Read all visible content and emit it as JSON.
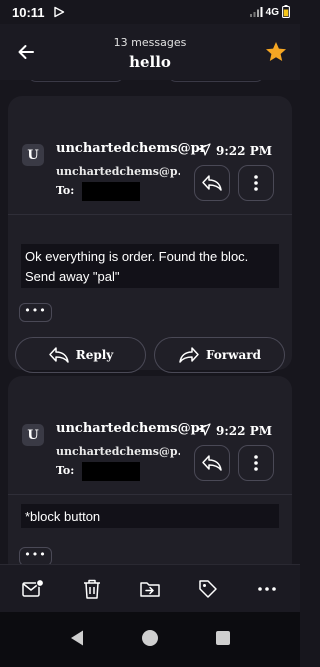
{
  "status_bar": {
    "time": "10:11",
    "network": "4G"
  },
  "header": {
    "message_count": "13 messages",
    "subject": "hello",
    "star_color": "#f5a623",
    "icons": [
      "back-arrow-icon",
      "star-icon"
    ]
  },
  "messages": [
    {
      "avatar_initial": "U",
      "sender_name": "unchartedchems@pr...",
      "sender_address": "unchartedchems@p...",
      "time": "9:22 PM",
      "to_label": "To:",
      "body": "Ok everything is order.  Found the bloc. Send away \"pal\"",
      "more_label": "•••",
      "reply_label": "Reply",
      "forward_label": "Forward"
    },
    {
      "avatar_initial": "U",
      "sender_name": "unchartedchems@pr...",
      "sender_address": "unchartedchems@p...",
      "time": "9:22 PM",
      "to_label": "To:",
      "body": "*block button",
      "more_label": "•••"
    }
  ],
  "toolbar": {
    "icons": [
      "mark-unread-icon",
      "trash-icon",
      "move-icon",
      "label-icon",
      "more-icon"
    ],
    "more_label": "···"
  },
  "system_nav": {
    "icons": [
      "nav-back-icon",
      "nav-home-icon",
      "nav-recents-icon"
    ]
  }
}
